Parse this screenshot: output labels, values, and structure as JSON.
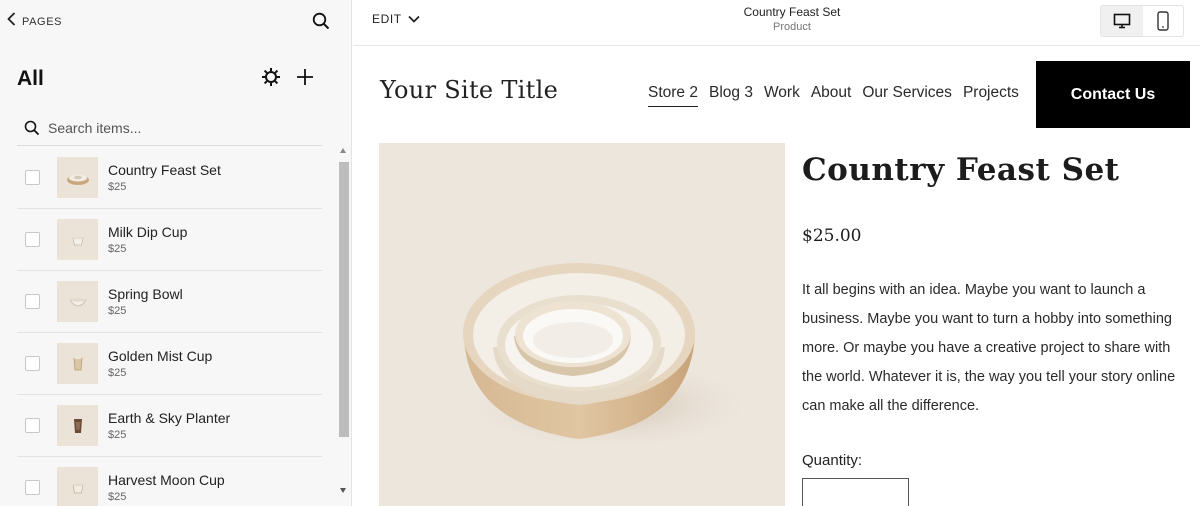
{
  "left_panel": {
    "back_label": "PAGES",
    "heading": "All",
    "search_placeholder": "Search items...",
    "items": [
      {
        "name": "Country Feast Set",
        "price": "$25"
      },
      {
        "name": "Milk Dip Cup",
        "price": "$25"
      },
      {
        "name": "Spring Bowl",
        "price": "$25"
      },
      {
        "name": "Golden Mist Cup",
        "price": "$25"
      },
      {
        "name": "Earth & Sky Planter",
        "price": "$25"
      },
      {
        "name": "Harvest Moon Cup",
        "price": "$25"
      }
    ]
  },
  "preview_bar": {
    "edit_label": "EDIT",
    "page_title": "Country Feast Set",
    "page_subtitle": "Product",
    "active_device": "desktop"
  },
  "site": {
    "title": "Your Site Title",
    "nav": [
      "Store 2",
      "Blog 3",
      "Work",
      "About",
      "Our Services",
      "Projects"
    ],
    "active_nav": "Store 2",
    "contact_label": "Contact Us"
  },
  "product": {
    "title": "Country Feast Set",
    "price": "$25.00",
    "description": "It all begins with an idea. Maybe you want to launch a business. Maybe you want to turn a hobby into something more. Or maybe you have a creative project to share with the world. Whatever it is, the way you tell your story online can make all the difference.",
    "quantity_label": "Quantity:",
    "quantity_value": ""
  },
  "colors": {
    "panel_bg": "#f7f7f7",
    "thumb_bg": "#ebe3d8",
    "image_bg": "#ede6dd",
    "button_bg": "#000000",
    "button_text": "#ffffff"
  },
  "icons": [
    "chevron-left-icon",
    "search-icon",
    "gear-icon",
    "plus-icon",
    "chevron-down-icon",
    "desktop-icon",
    "mobile-icon"
  ]
}
